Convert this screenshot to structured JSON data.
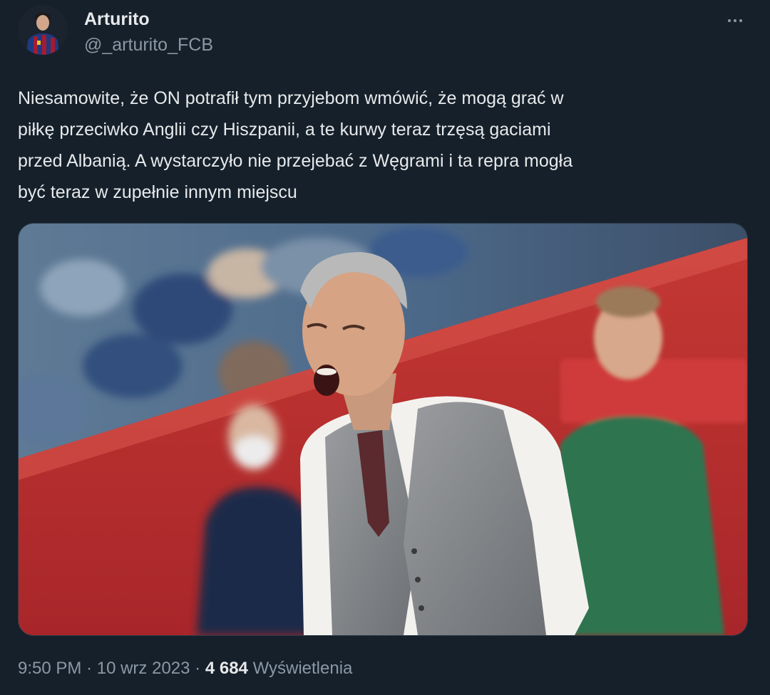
{
  "tweet": {
    "author": {
      "display_name": "Arturito",
      "handle": "@_arturito_FCB",
      "avatar_icon": "profile-avatar"
    },
    "text_lines": [
      "Niesamowite, że ON potrafił tym przyjebom wmówić, że mogą grać w",
      "piłkę przeciwko Anglii czy Hiszpanii, a te kurwy teraz trzęsą gaciami",
      "przed Albanią. A wystarczyło nie przejebać z Węgrami i ta repra mogła",
      "być teraz w zupełnie innym miejscu"
    ],
    "more_icon": "more-horizontal-icon",
    "media": {
      "type": "photo",
      "description_icon": "tweet-photo"
    },
    "meta": {
      "time": "9:50 PM",
      "separator": "·",
      "date": "10 wrz 2023",
      "views_count": "4 684",
      "views_label": "Wyświetlenia"
    }
  },
  "colors": {
    "background": "#15202b",
    "primary_text": "#e7e9ea",
    "secondary_text": "#8b98a5"
  }
}
